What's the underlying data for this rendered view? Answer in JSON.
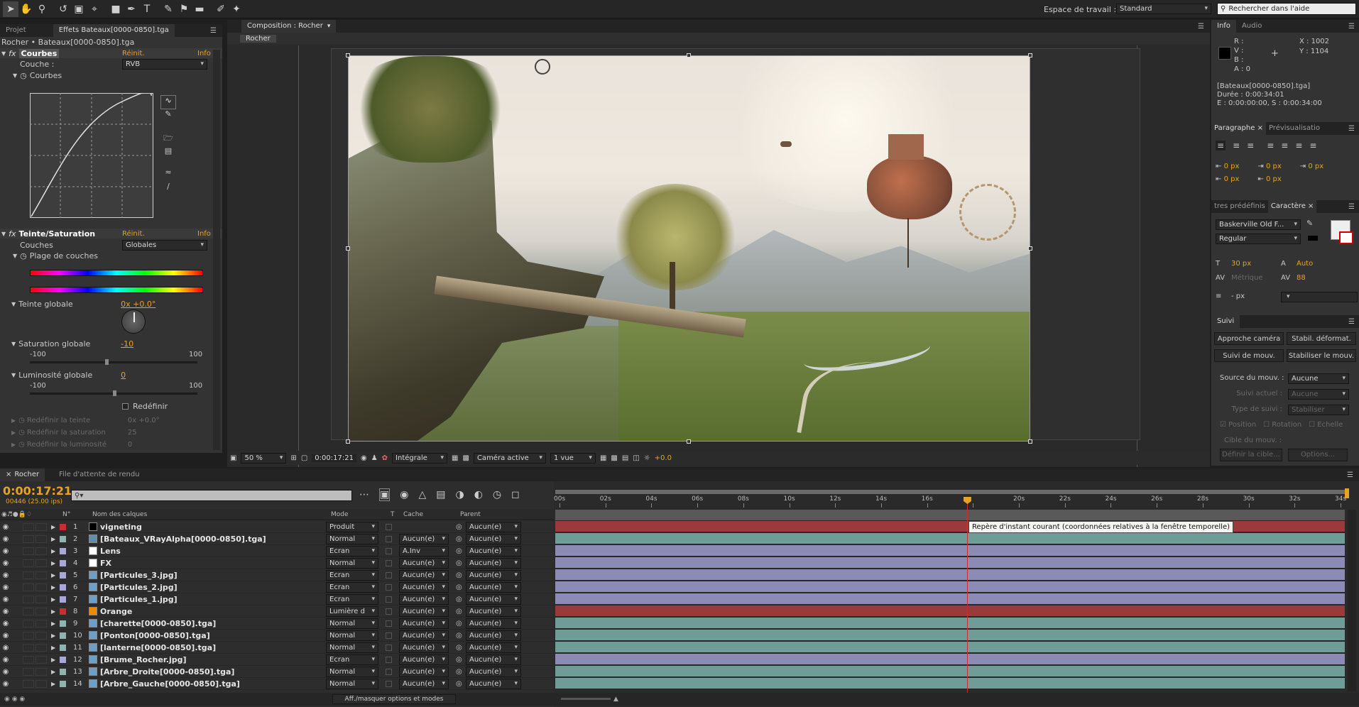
{
  "colors": {
    "accent": "#e8a320",
    "bg": "#1e1e1e",
    "panel": "#333333",
    "cti": "#d12a2a"
  },
  "toolbar": {
    "tools": [
      "selection-tool-icon",
      "hand-tool-icon",
      "zoom-tool-icon",
      "rotate-tool-icon",
      "camera-orbit-icon",
      "pan-behind-icon",
      "rectangle-tool-icon",
      "pen-tool-icon",
      "text-tool-icon",
      "brush-tool-icon",
      "clone-stamp-icon",
      "eraser-icon",
      "roto-brush-icon",
      "puppet-pin-icon"
    ],
    "workspace_label": "Espace de travail :",
    "workspace_value": "Standard",
    "help_placeholder": "Rechercher dans l'aide"
  },
  "effects_panel": {
    "tabs": [
      "Projet",
      "Effets Bateaux[0000-0850].tga"
    ],
    "breadcrumb": "Rocher • Bateaux[0000-0850].tga",
    "courbes": {
      "name": "Courbes",
      "reset": "Réinit.",
      "info": "Info",
      "channel_label": "Couche :",
      "channel_value": "RVB",
      "sub_label": "Courbes"
    },
    "teinte": {
      "name": "Teinte/Saturation",
      "reset": "Réinit.",
      "info": "Info",
      "couches_label": "Couches",
      "couches_value": "Globales",
      "plage": "Plage de couches",
      "teinte_globale": "Teinte globale",
      "teinte_value": "0x +0.0°",
      "saturation": "Saturation globale",
      "sat_value": "-10",
      "sat_min": "-100",
      "sat_max": "100",
      "luminosite": "Luminosité globale",
      "lum_value": "0",
      "lum_min": "-100",
      "lum_max": "100",
      "redefinir": "Redéfinir",
      "redef_teinte": "Redéfinir la teinte",
      "redef_teinte_val": "0x +0.0°",
      "redef_sat": "Redéfinir la saturation",
      "redef_sat_val": "25",
      "redef_lum": "Redéfinir la luminosité",
      "redef_lum_val": "0"
    }
  },
  "comp": {
    "tab": "Composition : Rocher",
    "sub_tab": "Rocher",
    "footer": {
      "zoom": "50 %",
      "time": "0:00:17:21",
      "resolution": "Intégrale",
      "camera": "Caméra active",
      "views": "1 vue",
      "exposure": "+0.0"
    }
  },
  "info_panel": {
    "tabs": [
      "Info",
      "Audio"
    ],
    "r": "R :",
    "v": "V :",
    "b": "B :",
    "a": "A : 0",
    "x": "X : 1002",
    "y": "Y : 1104",
    "file": "[Bateaux[0000-0850].tga]",
    "duration": "Durée : 0:00:34:01",
    "range": "E : 0:00:00:00, S : 0:00:34:00"
  },
  "paragraph": {
    "tabs": [
      "Paragraphe",
      "Prévisualisatio"
    ],
    "fields": [
      "0 px",
      "0 px",
      "0 px",
      "0 px",
      "0 px"
    ]
  },
  "character": {
    "tabs": [
      "tres prédéfinis",
      "Caractère"
    ],
    "font": "Baskerville Old F...",
    "style": "Regular",
    "size": "30 px",
    "leading": "Auto",
    "kerning": "Métrique",
    "tracking": "88",
    "stroke": "- px"
  },
  "tracker": {
    "tab": "Suivi",
    "buttons": [
      "Approche caméra",
      "Stabil. déformat.",
      "Suivi de mouv.",
      "Stabiliser le mouv."
    ],
    "source_label": "Source du mouv. :",
    "source_value": "Aucune",
    "current_label": "Suivi actuel :",
    "current_value": "Aucune",
    "type_label": "Type de suivi :",
    "type_value": "Stabiliser",
    "position": "Position",
    "rotation": "Rotation",
    "echelle": "Echelle",
    "target": "Cible du mouv. :",
    "define": "Définir la cible...",
    "options": "Options..."
  },
  "timeline": {
    "tabs": [
      "Rocher",
      "File d'attente de rendu"
    ],
    "timecode": "0:00:17:21",
    "frames": "00446 (25.00 ips)",
    "headers": {
      "num": "N°",
      "name": "Nom des calques",
      "mode": "Mode",
      "t": "T",
      "cache": "Cache",
      "parent": "Parent"
    },
    "ruler": [
      "00s",
      "02s",
      "04s",
      "06s",
      "08s",
      "10s",
      "12s",
      "14s",
      "16s",
      "",
      "20s",
      "22s",
      "24s",
      "26s",
      "28s",
      "30s",
      "32s",
      "34s"
    ],
    "cti_seconds": 17.74,
    "duration_seconds": 34,
    "tooltip": "Repère d'instant courant (coordonnées relatives à la fenêtre temporelle)",
    "footer": "Aff./masquer options et modes",
    "layers": [
      {
        "n": "1",
        "name": "vigneting",
        "label": "#c43030",
        "mode": "Produit",
        "cache": "",
        "parent": "Aucun(e)",
        "bar": "#9b3a3a",
        "thumb": "solid-black"
      },
      {
        "n": "2",
        "name": "[Bateaux_VRayAlpha[0000-0850].tga]",
        "label": "#8fb4b0",
        "mode": "Normal",
        "cache": "Aucun(e)",
        "parent": "Aucun(e)",
        "bar": "#6f9c96",
        "thumb": "sequence"
      },
      {
        "n": "3",
        "name": "Lens",
        "label": "#a8a8d8",
        "mode": "Ecran",
        "cache": "A.Inv",
        "parent": "Aucun(e)",
        "bar": "#8b8bb6",
        "thumb": "solid-white"
      },
      {
        "n": "4",
        "name": "FX",
        "label": "#a8a8d8",
        "mode": "Normal",
        "cache": "Aucun(e)",
        "parent": "Aucun(e)",
        "bar": "#8b8bb6",
        "thumb": "solid-white"
      },
      {
        "n": "5",
        "name": "[Particules_3.jpg]",
        "label": "#a8a8d8",
        "mode": "Ecran",
        "cache": "Aucun(e)",
        "parent": "Aucun(e)",
        "bar": "#8b8bb6",
        "thumb": "image"
      },
      {
        "n": "6",
        "name": "[Particules_2.jpg]",
        "label": "#a8a8d8",
        "mode": "Ecran",
        "cache": "Aucun(e)",
        "parent": "Aucun(e)",
        "bar": "#8b8bb6",
        "thumb": "image"
      },
      {
        "n": "7",
        "name": "[Particules_1.jpg]",
        "label": "#a8a8d8",
        "mode": "Ecran",
        "cache": "Aucun(e)",
        "parent": "Aucun(e)",
        "bar": "#8b8bb6",
        "thumb": "image"
      },
      {
        "n": "8",
        "name": "Orange",
        "label": "#c43030",
        "mode": "Lumière d",
        "cache": "Aucun(e)",
        "parent": "Aucun(e)",
        "bar": "#9b3a3a",
        "thumb": "solid-orange"
      },
      {
        "n": "9",
        "name": "[charette[0000-0850].tga]",
        "label": "#8fb4b0",
        "mode": "Normal",
        "cache": "Aucun(e)",
        "parent": "Aucun(e)",
        "bar": "#6f9c96",
        "thumb": "image"
      },
      {
        "n": "10",
        "name": "[Ponton[0000-0850].tga]",
        "label": "#8fb4b0",
        "mode": "Normal",
        "cache": "Aucun(e)",
        "parent": "Aucun(e)",
        "bar": "#6f9c96",
        "thumb": "image"
      },
      {
        "n": "11",
        "name": "[lanterne[0000-0850].tga]",
        "label": "#8fb4b0",
        "mode": "Normal",
        "cache": "Aucun(e)",
        "parent": "Aucun(e)",
        "bar": "#6f9c96",
        "thumb": "image"
      },
      {
        "n": "12",
        "name": "[Brume_Rocher.jpg]",
        "label": "#a8a8d8",
        "mode": "Ecran",
        "cache": "Aucun(e)",
        "parent": "Aucun(e)",
        "bar": "#8b8bb6",
        "thumb": "image"
      },
      {
        "n": "13",
        "name": "[Arbre_Droite[0000-0850].tga]",
        "label": "#8fb4b0",
        "mode": "Normal",
        "cache": "Aucun(e)",
        "parent": "Aucun(e)",
        "bar": "#6f9c96",
        "thumb": "image"
      },
      {
        "n": "14",
        "name": "[Arbre_Gauche[0000-0850].tga]",
        "label": "#8fb4b0",
        "mode": "Normal",
        "cache": "Aucun(e)",
        "parent": "Aucun(e)",
        "bar": "#6f9c96",
        "thumb": "image"
      }
    ]
  }
}
